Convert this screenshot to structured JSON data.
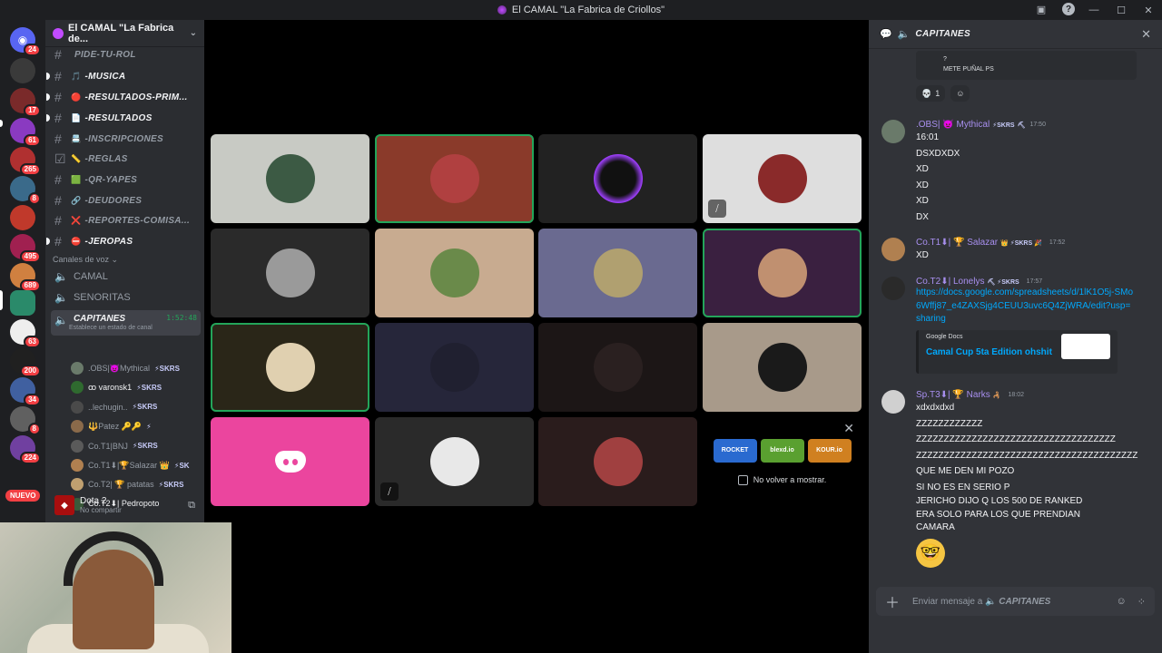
{
  "window": {
    "title": "El CAMAL \"La Fabrica de Criollos\""
  },
  "rail": {
    "badges": [
      "24",
      "17",
      "61",
      "265",
      "8",
      "495",
      "689",
      "63",
      "200",
      "34",
      "8",
      "224"
    ],
    "nuevo": "NUEVO"
  },
  "server": {
    "name": "El CAMAL \"La Fabrica de..."
  },
  "channels": [
    {
      "name": "PIDE-TU-ROL",
      "icon": "#",
      "emoji": ""
    },
    {
      "name": "-MUSICA",
      "icon": "#",
      "emoji": "🎵"
    },
    {
      "name": "-RESULTADOS-PRIM...",
      "icon": "#",
      "emoji": "🔴"
    },
    {
      "name": "-RESULTADOS",
      "icon": "#",
      "emoji": "📄"
    },
    {
      "name": "-INSCRIPCIONES",
      "icon": "#",
      "emoji": "📇"
    },
    {
      "name": "-REGLAS",
      "icon": "☑",
      "emoji": "📏"
    },
    {
      "name": "-QR-YAPES",
      "icon": "#",
      "emoji": "🟩"
    },
    {
      "name": "-DEUDORES",
      "icon": "#",
      "emoji": "🔗"
    },
    {
      "name": "-REPORTES-COMISA...",
      "icon": "#",
      "emoji": "❌"
    },
    {
      "name": "-JEROPAS",
      "icon": "#",
      "emoji": "⛔"
    }
  ],
  "voice_category": "Canales de voz",
  "voice_channels": [
    {
      "name": "CAMAL"
    },
    {
      "name": "SENORITAS"
    },
    {
      "name": "CAPITANES",
      "time": "1:52:48",
      "status": "Establece un estado de canal"
    }
  ],
  "voice_users": [
    {
      "name": ".OBS|👿Mythical",
      "tag": "⚡SKRS"
    },
    {
      "name": "ꝏ varonsk1",
      "tag": "⚡SKRS"
    },
    {
      "name": "..lechugin..",
      "tag": "⚡SKRS"
    },
    {
      "name": "🔱Patez 🔑🔑",
      "tag": "⚡"
    },
    {
      "name": "Co.T1|BNJ",
      "tag": "⚡SKRS"
    },
    {
      "name": "Co.T1⬇|🏆Salazar 👑",
      "tag": "⚡SK"
    },
    {
      "name": "Co.T2| 🏆 patatas",
      "tag": "⚡SKRS"
    },
    {
      "name": "Co.T2⬇| Pedropoto",
      "tag": ""
    }
  ],
  "activity": {
    "game": "Dota 2",
    "sub": "No compartir"
  },
  "grid": {
    "promo": {
      "games": [
        "ROCKET",
        "blexd.io",
        "KOUR.io"
      ],
      "dont_show": "No volver a mostrar."
    }
  },
  "chat": {
    "title": "CAPITANES",
    "quote_lines": [
      "?",
      "METE PUÑAL PS"
    ],
    "reactions": [
      {
        "emoji": "💀",
        "count": "1"
      },
      {
        "emoji": "☺",
        "count": ""
      }
    ],
    "messages": [
      {
        "name": ".OBS| 👿 Mythical",
        "tag": "⚡SKRS",
        "extra": "⛏",
        "time": "17:50",
        "lines": [
          "16:01",
          "DSXDXDX",
          "XD",
          "XD",
          "XD",
          "DX"
        ]
      },
      {
        "name": "Co.T1⬇| 🏆 Salazar",
        "tag": "👑 ⚡SKRS 🎉",
        "extra": "",
        "time": "17:52",
        "lines": [
          "XD"
        ]
      },
      {
        "name": "Co.T2⬇| Lonelys",
        "tag": "⛏ ⚡SKRS",
        "extra": "",
        "time": "17:57",
        "link": "https://docs.google.com/spreadsheets/d/1lK1O5j-SMo6Wffj87_e4ZAXSjg4CEUU3uvc6Q4ZjWRA/edit?usp=sharing",
        "embed": {
          "provider": "Google Docs",
          "title": "Camal Cup 5ta Edition ohshit"
        }
      },
      {
        "name": "Sp.T3⬇| 🏆 Narks",
        "tag": "🦂",
        "extra": "",
        "time": "18:02",
        "lines": [
          "xdxdxdxd",
          "ZZZZZZZZZZZZ",
          "ZZZZZZZZZZZZZZZZZZZZZZZZZZZZZZZZZZZZ",
          "ZZZZZZZZZZZZZZZZZZZZZZZZZZZZZZZZZZZZZZZZ",
          "QUE ME DEN MI POZO",
          "SI NO ES EN SERIO P",
          "JERICHO DIJO Q LOS 500 DE RANKED",
          "ERA SOLO PARA LOS QUE PRENDIAN",
          "CAMARA"
        ],
        "emoji": "🤓"
      }
    ],
    "composer_placeholder": "Enviar mensaje a",
    "composer_channel": "CAPITANES"
  }
}
